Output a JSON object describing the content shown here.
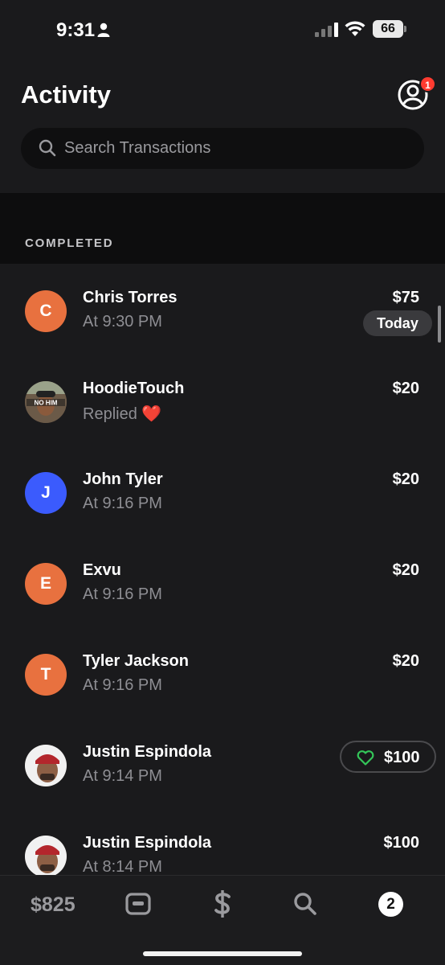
{
  "status_bar": {
    "time": "9:31",
    "battery": "66"
  },
  "header": {
    "title": "Activity",
    "notification_count": "1"
  },
  "search": {
    "placeholder": "Search Transactions"
  },
  "section": {
    "label": "COMPLETED"
  },
  "transactions": [
    {
      "initial": "C",
      "name": "Chris Torres",
      "sub": "At 9:30 PM",
      "amount": "$75",
      "tag": "Today",
      "avatar_color": "#e8713f"
    },
    {
      "initial": "",
      "name": "HoodieTouch",
      "sub": "Replied ❤️",
      "amount": "$20",
      "avatar_text": "NO HIM",
      "avatar_color": "#5b4a3c"
    },
    {
      "initial": "J",
      "name": "John Tyler",
      "sub": "At 9:16 PM",
      "amount": "$20",
      "avatar_color": "#3b5bfd"
    },
    {
      "initial": "E",
      "name": "Exvu",
      "sub": "At 9:16 PM",
      "amount": "$20",
      "avatar_color": "#e8713f"
    },
    {
      "initial": "T",
      "name": "Tyler Jackson",
      "sub": "At 9:16 PM",
      "amount": "$20",
      "avatar_color": "#e8713f"
    },
    {
      "initial": "",
      "name": "Justin Espindola",
      "sub": "At 9:14 PM",
      "amount": "$100",
      "liked": true
    },
    {
      "initial": "",
      "name": "Justin Espindola",
      "sub": "At 8:14 PM",
      "amount": "$100"
    }
  ],
  "tabbar": {
    "balance": "$825",
    "activity_count": "2"
  },
  "colors": {
    "background": "#1a1a1c",
    "orange": "#e8713f",
    "blue": "#3b5bfd",
    "liked_green": "#34c759",
    "badge_red": "#ff3b30"
  },
  "icons": [
    "person-icon",
    "signal-icon",
    "wifi-icon",
    "profile-icon",
    "search-icon",
    "heart-icon",
    "card-icon",
    "dollar-icon",
    "search-tab-icon"
  ]
}
